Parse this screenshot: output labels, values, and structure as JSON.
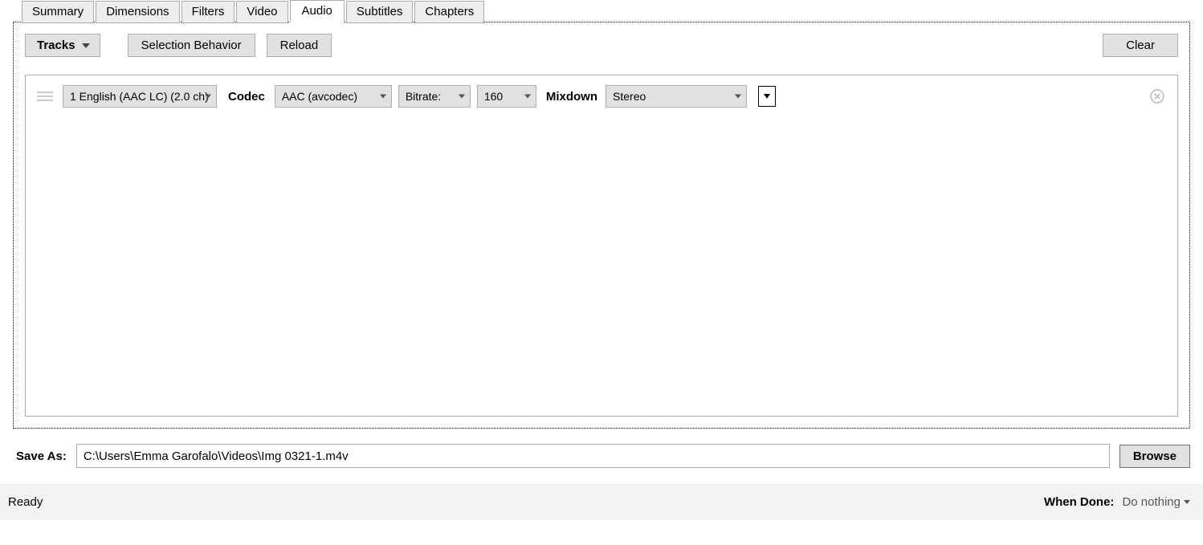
{
  "tabs": {
    "summary": "Summary",
    "dimensions": "Dimensions",
    "filters": "Filters",
    "video": "Video",
    "audio": "Audio",
    "subtitles": "Subtitles",
    "chapters": "Chapters",
    "active": "audio"
  },
  "toolbar": {
    "tracks_label": "Tracks",
    "selection_behavior_label": "Selection Behavior",
    "reload_label": "Reload",
    "clear_label": "Clear"
  },
  "track": {
    "source": "1 English (AAC LC) (2.0 ch)",
    "codec_label": "Codec",
    "codec_value": "AAC (avcodec)",
    "bitrate_label": "Bitrate:",
    "bitrate_value": "160",
    "mixdown_label": "Mixdown",
    "mixdown_value": "Stereo"
  },
  "save": {
    "label": "Save As:",
    "path": "C:\\Users\\Emma Garofalo\\Videos\\Img 0321-1.m4v",
    "browse_label": "Browse"
  },
  "status": {
    "ready": "Ready",
    "when_done_label": "When Done:",
    "when_done_value": "Do nothing"
  }
}
